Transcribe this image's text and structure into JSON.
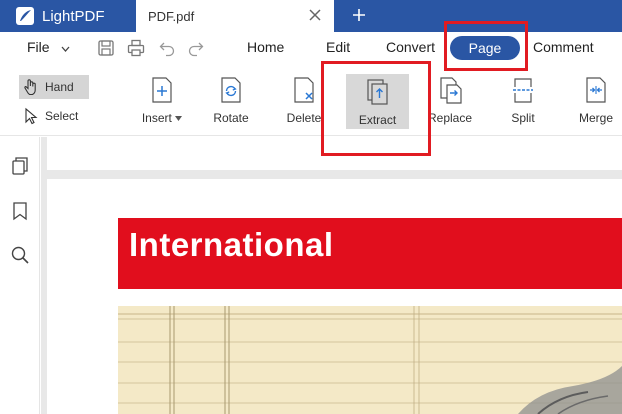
{
  "app": {
    "name": "LightPDF"
  },
  "tabs": [
    {
      "label": "PDF.pdf"
    }
  ],
  "menu": {
    "file_label": "File",
    "items": [
      "Home",
      "Edit",
      "Convert",
      "Page",
      "Comment"
    ],
    "active": "Page"
  },
  "modes": {
    "hand": "Hand",
    "select": "Select"
  },
  "tools": {
    "insert": "Insert",
    "rotate": "Rotate",
    "delete": "Delete",
    "extract": "Extract",
    "replace": "Replace",
    "split": "Split",
    "merge": "Merge"
  },
  "document": {
    "banner_text": "International"
  },
  "colors": {
    "brand": "#2a56a4",
    "highlight": "#e11b22",
    "banner": "#e10e1d"
  }
}
